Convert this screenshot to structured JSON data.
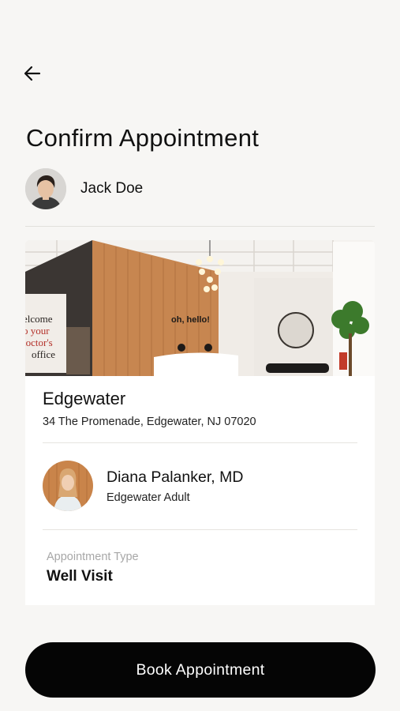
{
  "header": {
    "back_icon": "arrow-left-icon",
    "title": "Confirm Appointment"
  },
  "patient": {
    "name": "Jack Doe",
    "avatar_icon": "user-avatar"
  },
  "location": {
    "name": "Edgewater",
    "address": "34 The Promenade, Edgewater, NJ 07020",
    "photo_sign_text": "oh, hello!",
    "photo_wall_text": [
      "elcome",
      "o your",
      "loctor's",
      "office"
    ]
  },
  "doctor": {
    "name": "Diana Palanker, MD",
    "practice": "Edgewater Adult"
  },
  "appointment": {
    "type_label": "Appointment Type",
    "type_value": "Well Visit"
  },
  "actions": {
    "book_label": "Book Appointment"
  },
  "colors": {
    "background": "#f7f6f4",
    "card": "#ffffff",
    "button": "#050505",
    "muted_text": "#a7a7a7"
  }
}
